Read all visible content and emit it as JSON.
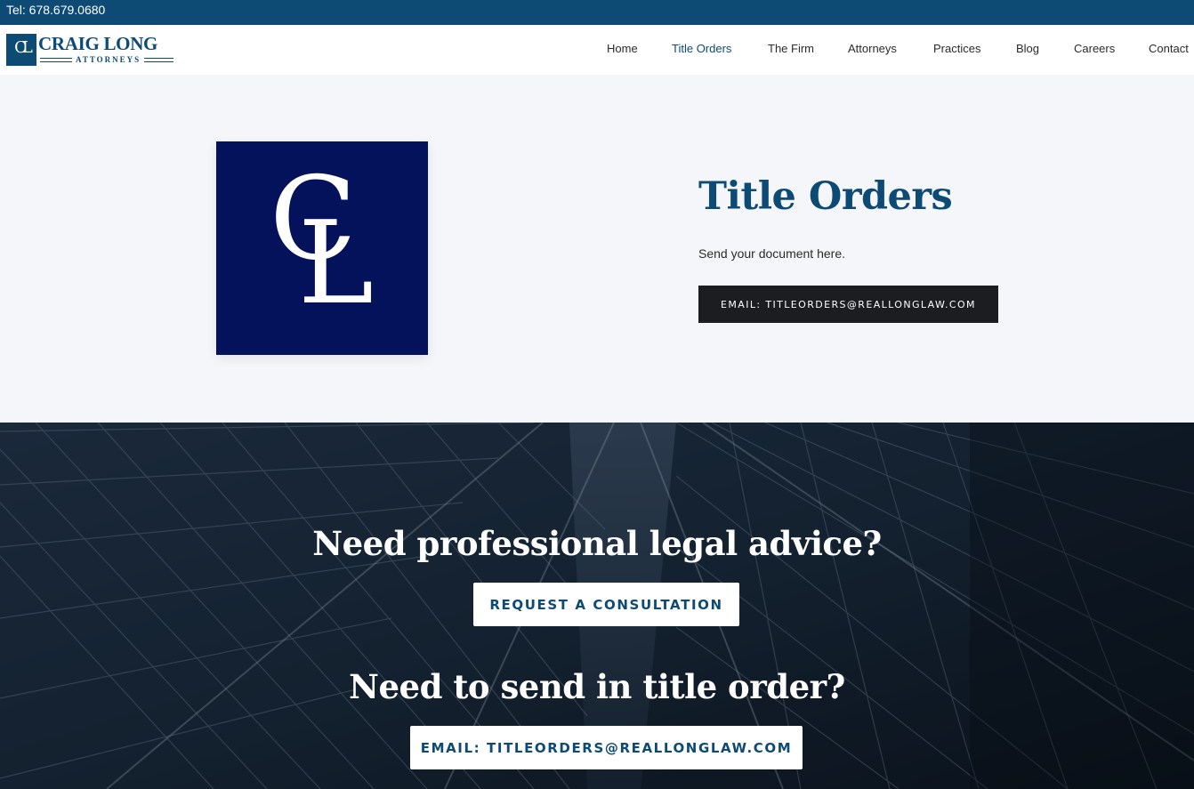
{
  "topbar": {
    "phone": "Tel: 678.679.0680"
  },
  "brand": {
    "monogram": "CL",
    "name": "CRAIG LONG",
    "tagline": "ATTORNEYS"
  },
  "nav": {
    "items": [
      {
        "label": "Home",
        "active": false
      },
      {
        "label": "Title Orders",
        "active": true
      },
      {
        "label": "The Firm",
        "active": false
      },
      {
        "label": "Attorneys",
        "active": false
      },
      {
        "label": "Practices",
        "active": false
      },
      {
        "label": "Blog",
        "active": false
      },
      {
        "label": "Careers",
        "active": false
      },
      {
        "label": "Contact",
        "active": false
      }
    ]
  },
  "hero": {
    "card_letters": {
      "c": "C",
      "l": "L"
    },
    "title": "Title Orders",
    "subtitle": "Send your document here.",
    "email_button": "EMAIL: TITLEORDERS@REALLONGLAW.COM"
  },
  "cta": {
    "heading_advice": "Need professional legal advice?",
    "consult_button": "REQUEST A CONSULTATION",
    "heading_title_order": "Need to send in title order?",
    "email_button": "EMAIL: TITLEORDERS@REALLONGLAW.COM"
  },
  "colors": {
    "brand_blue": "#0d4a74",
    "card_navy": "#03125a",
    "dark_button": "#1c1d20",
    "hero_bg": "#f5f6f9"
  }
}
